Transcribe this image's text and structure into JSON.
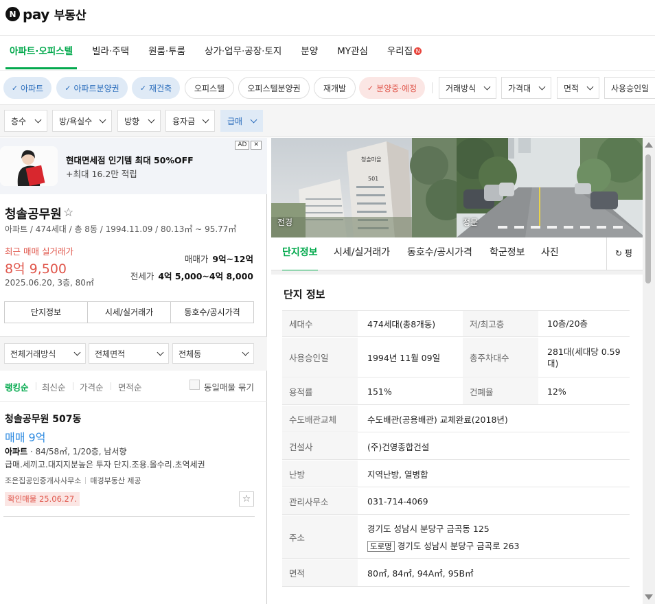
{
  "brand": {
    "n": "N",
    "pay": "pay",
    "title": "부동산"
  },
  "nav": {
    "tabs": [
      "아파트·오피스텔",
      "빌라·주택",
      "원룸·투룸",
      "상가·업무·공장·토지",
      "분양",
      "MY관심",
      "우리집"
    ],
    "badge": "N"
  },
  "filters": {
    "chips": [
      "아파트",
      "아파트분양권",
      "재건축",
      "오피스텔",
      "오피스텔분양권",
      "재개발",
      "분양중·예정"
    ],
    "check": "✓",
    "selects1": [
      "거래방식",
      "가격대",
      "면적",
      "사용승인일"
    ],
    "selects2": [
      "층수",
      "방/욕실수",
      "방향",
      "융자금",
      "급매"
    ]
  },
  "ad": {
    "line1": "현대면세점 인기템 최대 50%OFF",
    "line2": "+최대 16.2만 적립",
    "tag": "AD",
    "close": "✕"
  },
  "complex": {
    "name": "청솔공무원",
    "star": "☆",
    "meta": "아파트 / 474세대 / 총 8동 / 1994.11.09 / 80.13㎡ ~ 95.77㎡",
    "recent_label": "최근 매매 실거래가",
    "recent_price": "8억 9,500",
    "recent_date": "2025.06.20, 3층, 80㎡",
    "sale_label": "매매가",
    "sale_value": "9억~12억",
    "jeonse_label": "전세가",
    "jeonse_value": "4억 5,000~4억 8,000"
  },
  "left_tabs": [
    "단지정보",
    "시세/실거래가",
    "동호수/공시가격"
  ],
  "left_filters": [
    "전체거래방식",
    "전체면적",
    "전체동"
  ],
  "sort": {
    "items": [
      "랭킹순",
      "최신순",
      "가격순",
      "면적순"
    ],
    "same_listing": "동일매물 묶기"
  },
  "listing": {
    "title": "청솔공무원 507동",
    "price": "매매 9억",
    "type": "아파트",
    "spec": "84/58㎡, 1/20층, 남서향",
    "desc": "급매.세끼고.대지지분높은 투자 단지.조용.올수리.초역세권",
    "agency": "조은집공인중개사사무소",
    "provider": "매경부동산 제공",
    "confirm": "확인매물 25.06.27.",
    "star": "☆"
  },
  "photos": {
    "front": "전경",
    "gate": "정문",
    "sign1": "청솔마을",
    "sign2": "501"
  },
  "right_tabs": [
    "단지정보",
    "시세/실거래가",
    "동호수/공시가격",
    "학군정보",
    "사진"
  ],
  "pyeong": {
    "icon": "↻",
    "label": "평"
  },
  "info": {
    "title": "단지 정보",
    "households_label": "세대수",
    "households": "474세대(총8개동)",
    "floors_label": "저/최고층",
    "floors": "10층/20층",
    "approval_label": "사용승인일",
    "approval": "1994년 11월 09일",
    "parking_label": "총주차대수",
    "parking": "281대(세대당 0.59대)",
    "far_label": "용적률",
    "far": "151%",
    "bcr_label": "건폐율",
    "bcr": "12%",
    "pipe_label": "수도배관교체",
    "pipe": "수도배관(공용배관) 교체완료(2018년)",
    "builder_label": "건설사",
    "builder": "(주)건영종합건설",
    "heating_label": "난방",
    "heating": "지역난방, 열병합",
    "office_label": "관리사무소",
    "office": "031-714-4069",
    "address_label": "주소",
    "address": "경기도 성남시 분당구 금곡동 125",
    "road_tag": "도로명",
    "road_address": "경기도 성남시 분당구 금곡로 263",
    "area_label": "면적",
    "area": "80㎡, 84㎡, 94A㎡, 95B㎡"
  }
}
